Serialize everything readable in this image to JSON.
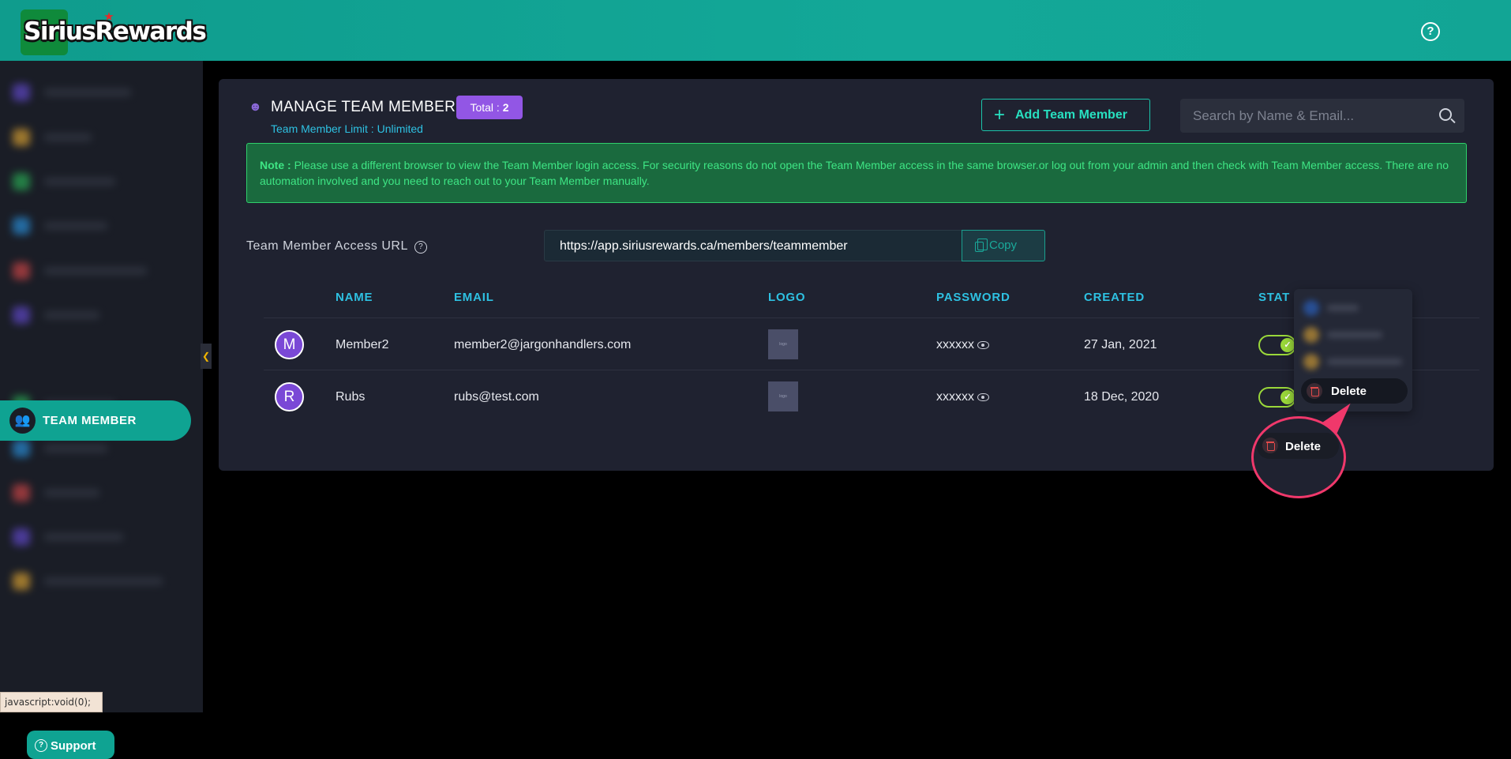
{
  "header": {
    "logo_text": "SiriusRewards"
  },
  "sidebar": {
    "active_item": "TEAM MEMBER",
    "support_label": "Support",
    "blurred_colors": [
      "#6a4ee0",
      "#f2b233",
      "#2bbf5a",
      "#2b9ef2",
      "#e24a4a",
      "#6a4ee0",
      "#2bbf5a",
      "#2b9ef2",
      "#e24a4a",
      "#6a4ee0",
      "#f2b233"
    ]
  },
  "status_bar_text": "javascript:void(0);",
  "panel": {
    "title": "MANAGE TEAM MEMBER",
    "total_label": "Total :",
    "total_count": "2",
    "limit_text": "Team Member Limit : Unlimited",
    "add_button": "Add Team Member",
    "search_placeholder": "Search by Name & Email...",
    "note_label": "Note :",
    "note_text": "Please use a different browser to view the Team Member login access. For security reasons do not open the Team Member access in the same browser.or log out from your admin and then check with Team Member access. There are no automation involved and you need to reach out to your Team Member manually.",
    "url_label": "Team Member Access URL",
    "url_value": "https://app.siriusrewards.ca/members/teammember",
    "copy_label": "Copy"
  },
  "table": {
    "headers": {
      "name": "NAME",
      "email": "EMAIL",
      "logo": "LOGO",
      "password": "PASSWORD",
      "created": "CREATED",
      "status": "STATUS"
    },
    "rows": [
      {
        "initial": "M",
        "name": "Member2",
        "email": "member2@jargonhandlers.com",
        "password": "xxxxxx",
        "created": "27 Jan, 2021"
      },
      {
        "initial": "R",
        "name": "Rubs",
        "email": "rubs@test.com",
        "password": "xxxxxx",
        "created": "18 Dec, 2020"
      }
    ]
  },
  "dropdown": {
    "delete_label": "Delete"
  },
  "callout": {
    "delete_label": "Delete"
  },
  "colors": {
    "topbar": "#12a595",
    "accent_purple": "#9256e5",
    "accent_teal": "#0fa392",
    "note_green": "#3ee584",
    "highlight_pink": "#f0386b"
  }
}
